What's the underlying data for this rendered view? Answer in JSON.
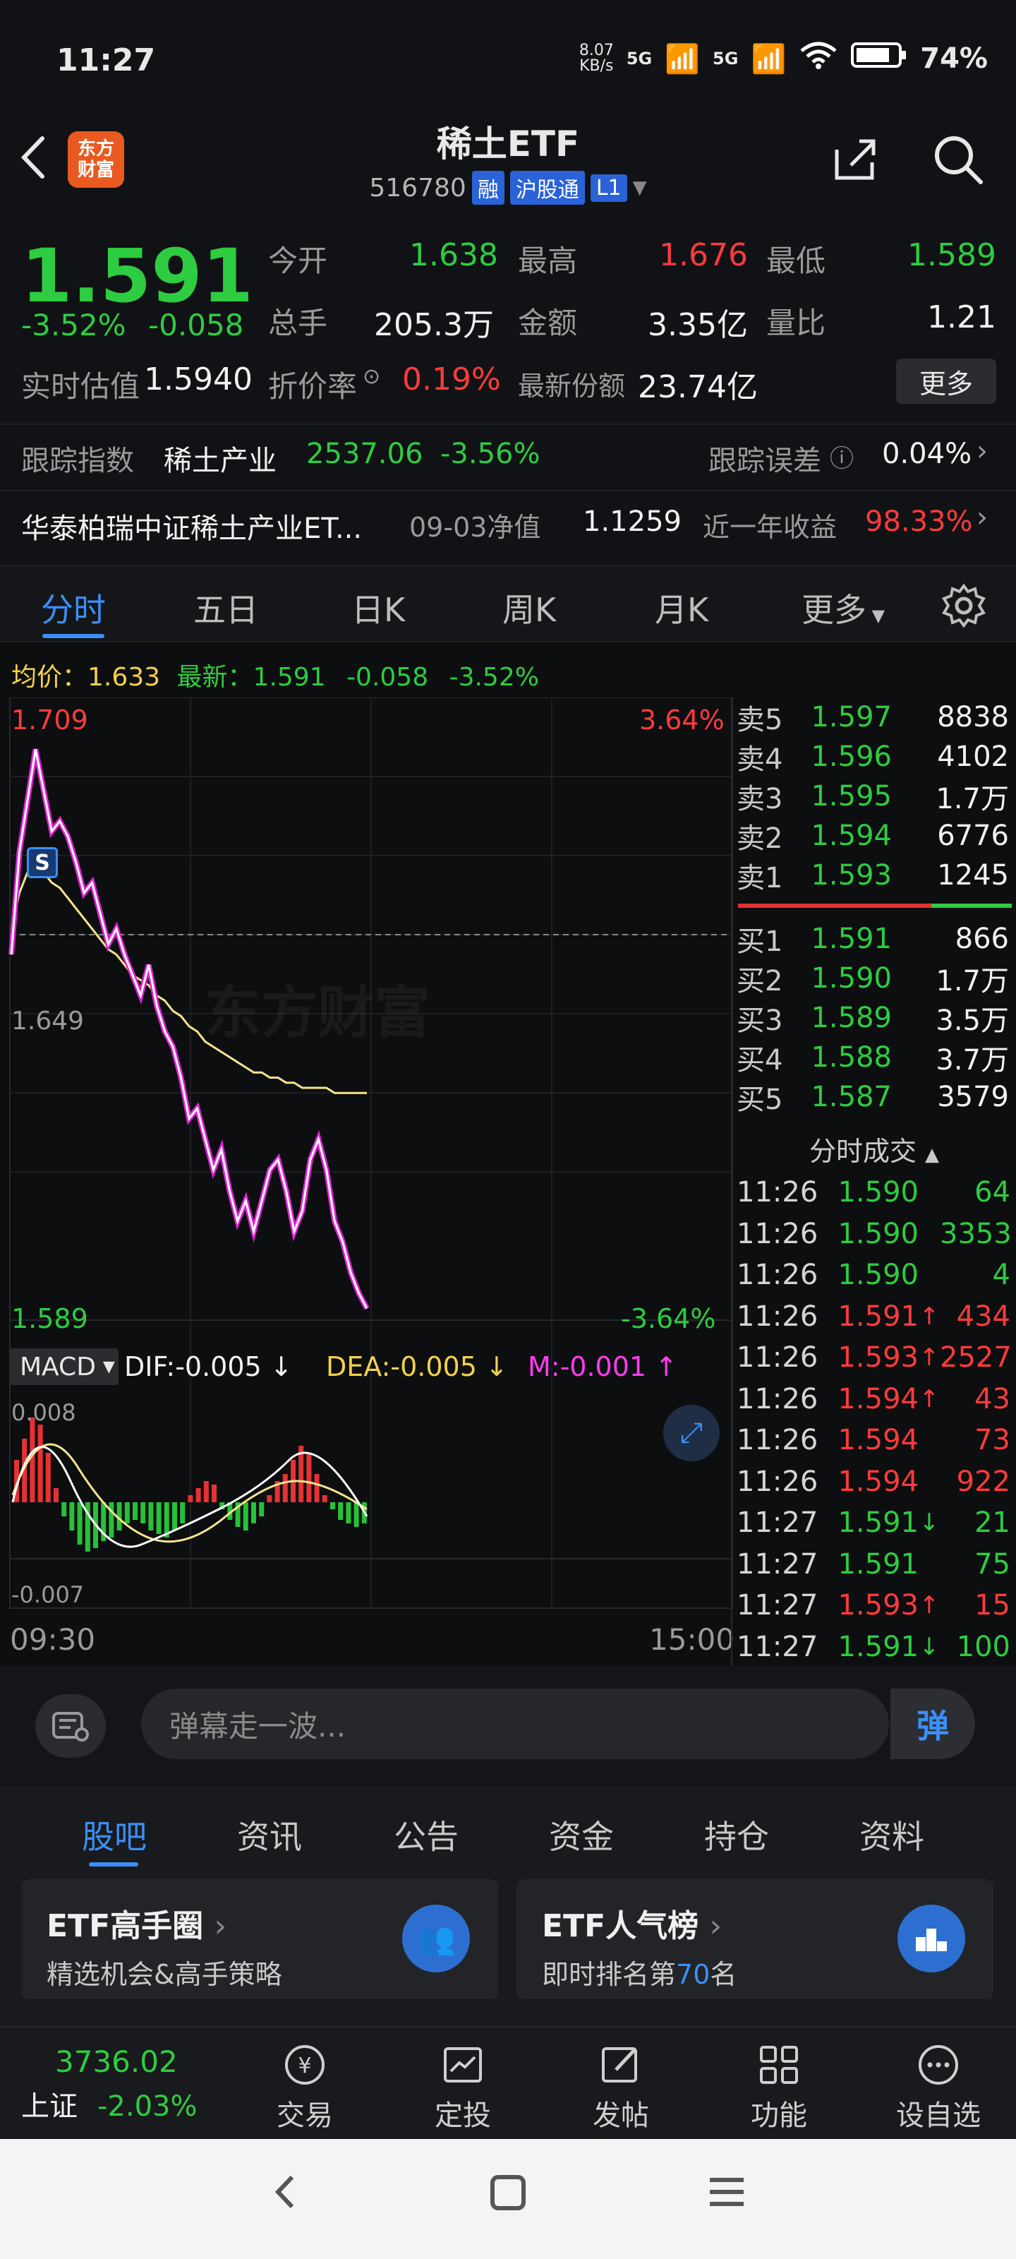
{
  "status_bar": {
    "time": "11:27",
    "speed_top": "8.07",
    "speed_bottom": "KB/s",
    "net1": "5G",
    "net2": "5G",
    "battery": "74%"
  },
  "header": {
    "title": "稀土ETF",
    "code": "516780",
    "tags": [
      "融",
      "沪股通",
      "L1"
    ],
    "logo_line1": "东方",
    "logo_line2": "财富"
  },
  "quote": {
    "price": "1.591",
    "change_pct": "-3.52%",
    "change": "-0.058",
    "open_label": "今开",
    "open": "1.638",
    "high_label": "最高",
    "high": "1.676",
    "low_label": "最低",
    "low": "1.589",
    "volume_label": "总手",
    "volume": "205.3万",
    "amount_label": "金额",
    "amount": "3.35亿",
    "ratio_label": "量比",
    "ratio": "1.21",
    "iopv_label": "实时估值",
    "iopv": "1.5940",
    "discount_label": "折价率",
    "discount": "0.19%",
    "shares_label": "最新份额",
    "shares": "23.74亿",
    "more": "更多",
    "index_label": "跟踪指数",
    "index_name": "稀土产业",
    "index_value": "2537.06",
    "index_pct": "-3.56%",
    "error_label": "跟踪误差",
    "error_value": "0.04%",
    "fund_name": "华泰柏瑞中证稀土产业ET...",
    "nav_label": "09-03净值",
    "nav_value": "1.1259",
    "year_label": "近一年收益",
    "year_value": "98.33%"
  },
  "tabs": [
    "分时",
    "五日",
    "日K",
    "周K",
    "月K",
    "更多"
  ],
  "chart_header": {
    "avg_label": "均价：",
    "avg": "1.633",
    "latest_label": "最新：",
    "latest": "1.591",
    "chg": "-0.058",
    "pct": "-3.52%"
  },
  "chart_axis": {
    "top_price": "1.709",
    "bottom_price": "1.589",
    "top_pct": "3.64%",
    "bottom_pct": "-3.64%",
    "mid_price": "1.649",
    "time_start": "09:30",
    "time_end": "15:00",
    "watermark": "东方财富"
  },
  "chart_data": {
    "type": "line",
    "title": "",
    "ylim": [
      1.589,
      1.709
    ],
    "series": [
      {
        "name": "",
        "values": [
          1.66,
          1.68,
          1.69,
          1.7,
          1.692,
          1.684,
          1.686,
          1.683,
          1.678,
          1.672,
          1.674,
          1.668,
          1.662,
          1.665,
          1.66,
          1.656,
          1.652,
          1.658,
          1.65,
          1.645,
          1.642,
          1.636,
          1.628,
          1.63,
          1.624,
          1.618,
          1.622,
          1.614,
          1.608,
          1.612,
          1.606,
          1.612,
          1.618,
          1.62,
          1.614,
          1.606,
          1.61,
          1.62,
          1.624,
          1.618,
          1.608,
          1.604,
          1.598,
          1.594,
          1.591
        ]
      },
      {
        "name": "",
        "values": [
          1.665,
          1.672,
          1.676,
          1.677,
          1.676,
          1.674,
          1.673,
          1.671,
          1.669,
          1.667,
          1.665,
          1.663,
          1.661,
          1.66,
          1.658,
          1.656,
          1.655,
          1.654,
          1.652,
          1.651,
          1.649,
          1.648,
          1.646,
          1.645,
          1.643,
          1.642,
          1.641,
          1.64,
          1.639,
          1.638,
          1.637,
          1.637,
          1.636,
          1.636,
          1.635,
          1.635,
          1.634,
          1.634,
          1.634,
          1.634,
          1.633,
          1.633,
          1.633,
          1.633,
          1.633
        ]
      }
    ]
  },
  "macd": {
    "label": "MACD",
    "dif_label": "DIF:",
    "dif": "-0.005",
    "dea_label": "DEA:",
    "dea": "-0.005",
    "m_label": "M:",
    "m": "-0.001",
    "top": "0.008",
    "bottom": "-0.007"
  },
  "order_book": {
    "asks": [
      {
        "label": "卖5",
        "price": "1.597",
        "vol": "8838"
      },
      {
        "label": "卖4",
        "price": "1.596",
        "vol": "4102"
      },
      {
        "label": "卖3",
        "price": "1.595",
        "vol": "1.7万"
      },
      {
        "label": "卖2",
        "price": "1.594",
        "vol": "6776"
      },
      {
        "label": "卖1",
        "price": "1.593",
        "vol": "1245"
      }
    ],
    "bids": [
      {
        "label": "买1",
        "price": "1.591",
        "vol": "866"
      },
      {
        "label": "买2",
        "price": "1.590",
        "vol": "1.7万"
      },
      {
        "label": "买3",
        "price": "1.589",
        "vol": "3.5万"
      },
      {
        "label": "买4",
        "price": "1.588",
        "vol": "3.7万"
      },
      {
        "label": "买5",
        "price": "1.587",
        "vol": "3579"
      }
    ]
  },
  "trades_title": "分时成交",
  "trades": [
    {
      "time": "11:26",
      "price": "1.590",
      "arrow": "",
      "vol": "64",
      "dir": "down"
    },
    {
      "time": "11:26",
      "price": "1.590",
      "arrow": "",
      "vol": "3353",
      "dir": "down"
    },
    {
      "time": "11:26",
      "price": "1.590",
      "arrow": "",
      "vol": "4",
      "dir": "down"
    },
    {
      "time": "11:26",
      "price": "1.591",
      "arrow": "↑",
      "vol": "434",
      "dir": "up"
    },
    {
      "time": "11:26",
      "price": "1.593",
      "arrow": "↑",
      "vol": "2527",
      "dir": "up"
    },
    {
      "time": "11:26",
      "price": "1.594",
      "arrow": "↑",
      "vol": "43",
      "dir": "up"
    },
    {
      "time": "11:26",
      "price": "1.594",
      "arrow": "",
      "vol": "73",
      "dir": "up"
    },
    {
      "time": "11:26",
      "price": "1.594",
      "arrow": "",
      "vol": "922",
      "dir": "up"
    },
    {
      "time": "11:27",
      "price": "1.591",
      "arrow": "↓",
      "vol": "21",
      "dir": "down"
    },
    {
      "time": "11:27",
      "price": "1.591",
      "arrow": "",
      "vol": "75",
      "dir": "down"
    },
    {
      "time": "11:27",
      "price": "1.593",
      "arrow": "↑",
      "vol": "15",
      "dir": "up"
    },
    {
      "time": "11:27",
      "price": "1.591",
      "arrow": "↓",
      "vol": "100",
      "dir": "down"
    }
  ],
  "danmu": {
    "placeholder": "弹幕走一波...",
    "button": "弹"
  },
  "info_tabs": [
    "股吧",
    "资讯",
    "公告",
    "资金",
    "持仓",
    "资料"
  ],
  "promos": [
    {
      "title": "ETF高手圈",
      "subtitle": "精选机会&高手策略"
    },
    {
      "title": "ETF人气榜",
      "subtitle_pre": "即时排名第",
      "rank": "70",
      "subtitle_post": "名"
    }
  ],
  "bottom_nav": {
    "index_value": "3736.02",
    "index_name": "上证",
    "index_pct": "-2.03%",
    "items": [
      "交易",
      "定投",
      "发帖",
      "功能",
      "设自选"
    ]
  }
}
